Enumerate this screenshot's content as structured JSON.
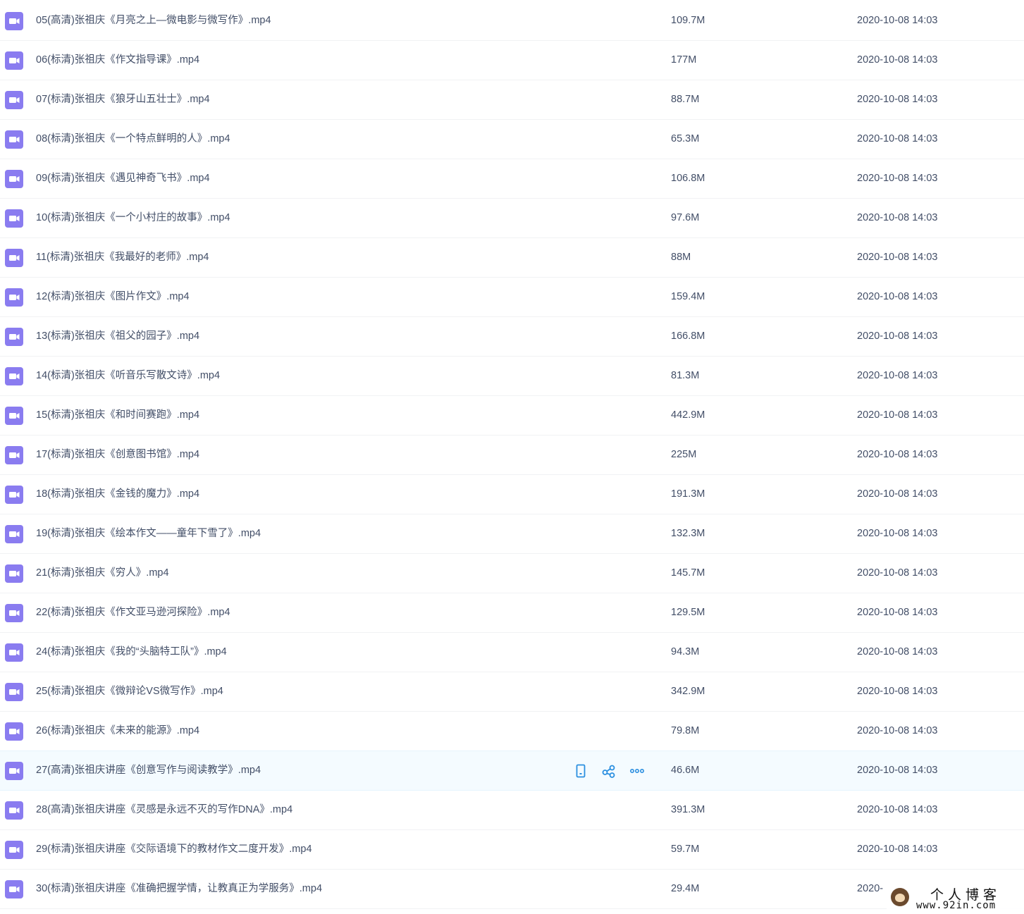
{
  "colors": {
    "accent": "#2b8fe0",
    "video_icon": "#8a7cf0",
    "text": "#424e67",
    "hover_row": "#f4fbff"
  },
  "files": [
    {
      "name": "05(高清)张祖庆《月亮之上—微电影与微写作》.mp4",
      "size": "109.7M",
      "time": "2020-10-08 14:03",
      "icon": "video-file-icon"
    },
    {
      "name": "06(标清)张祖庆《作文指导课》.mp4",
      "size": "177M",
      "time": "2020-10-08 14:03",
      "icon": "video-file-icon"
    },
    {
      "name": "07(标清)张祖庆《狼牙山五壮士》.mp4",
      "size": "88.7M",
      "time": "2020-10-08 14:03",
      "icon": "video-file-icon"
    },
    {
      "name": "08(标清)张祖庆《一个特点鲜明的人》.mp4",
      "size": "65.3M",
      "time": "2020-10-08 14:03",
      "icon": "video-file-icon"
    },
    {
      "name": "09(标清)张祖庆《遇见神奇飞书》.mp4",
      "size": "106.8M",
      "time": "2020-10-08 14:03",
      "icon": "video-file-icon"
    },
    {
      "name": "10(标清)张祖庆《一个小村庄的故事》.mp4",
      "size": "97.6M",
      "time": "2020-10-08 14:03",
      "icon": "video-file-icon"
    },
    {
      "name": "11(标清)张祖庆《我最好的老师》.mp4",
      "size": "88M",
      "time": "2020-10-08 14:03",
      "icon": "video-file-icon"
    },
    {
      "name": "12(标清)张祖庆《图片作文》.mp4",
      "size": "159.4M",
      "time": "2020-10-08 14:03",
      "icon": "video-file-icon"
    },
    {
      "name": "13(标清)张祖庆《祖父的园子》.mp4",
      "size": "166.8M",
      "time": "2020-10-08 14:03",
      "icon": "video-file-icon"
    },
    {
      "name": "14(标清)张祖庆《听音乐写散文诗》.mp4",
      "size": "81.3M",
      "time": "2020-10-08 14:03",
      "icon": "video-file-icon"
    },
    {
      "name": "15(标清)张祖庆《和时间赛跑》.mp4",
      "size": "442.9M",
      "time": "2020-10-08 14:03",
      "icon": "video-file-icon"
    },
    {
      "name": "17(标清)张祖庆《创意图书馆》.mp4",
      "size": "225M",
      "time": "2020-10-08 14:03",
      "icon": "video-file-icon"
    },
    {
      "name": "18(标清)张祖庆《金钱的魔力》.mp4",
      "size": "191.3M",
      "time": "2020-10-08 14:03",
      "icon": "video-file-icon"
    },
    {
      "name": "19(标清)张祖庆《绘本作文——童年下雪了》.mp4",
      "size": "132.3M",
      "time": "2020-10-08 14:03",
      "icon": "video-file-icon"
    },
    {
      "name": "21(标清)张祖庆《穷人》.mp4",
      "size": "145.7M",
      "time": "2020-10-08 14:03",
      "icon": "video-file-icon"
    },
    {
      "name": "22(标清)张祖庆《作文亚马逊河探险》.mp4",
      "size": "129.5M",
      "time": "2020-10-08 14:03",
      "icon": "video-file-icon"
    },
    {
      "name": "24(标清)张祖庆《我的“头脑特工队”》.mp4",
      "size": "94.3M",
      "time": "2020-10-08 14:03",
      "icon": "video-file-icon"
    },
    {
      "name": "25(标清)张祖庆《微辩论VS微写作》.mp4",
      "size": "342.9M",
      "time": "2020-10-08 14:03",
      "icon": "video-file-icon"
    },
    {
      "name": "26(标清)张祖庆《未来的能源》.mp4",
      "size": "79.8M",
      "time": "2020-10-08 14:03",
      "icon": "video-file-icon"
    },
    {
      "name": "27(高清)张祖庆讲座《创意写作与阅读教学》.mp4",
      "size": "46.6M",
      "time": "2020-10-08 14:03",
      "icon": "video-file-icon",
      "hovered": true
    },
    {
      "name": "28(高清)张祖庆讲座《灵感是永远不灭的写作DNA》.mp4",
      "size": "391.3M",
      "time": "2020-10-08 14:03",
      "icon": "video-file-icon"
    },
    {
      "name": "29(标清)张祖庆讲座《交际语境下的教材作文二度开发》.mp4",
      "size": "59.7M",
      "time": "2020-10-08 14:03",
      "icon": "video-file-icon"
    },
    {
      "name": "30(标清)张祖庆讲座《准确把握学情，让教真正为学服务》.mp4",
      "size": "29.4M",
      "time": "2020-",
      "icon": "video-file-icon"
    }
  ],
  "row_actions": [
    {
      "name": "phone-icon"
    },
    {
      "name": "share-icon"
    },
    {
      "name": "more-icon"
    }
  ],
  "watermark": {
    "title": "个人博客",
    "url": "www.92in.com"
  }
}
